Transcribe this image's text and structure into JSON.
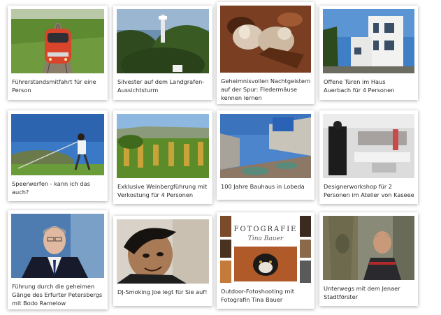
{
  "cards": [
    {
      "caption": "Führerstandsmitfahrt für eine Person",
      "icon": "train-photo"
    },
    {
      "caption": "Silvester auf dem Landgrafen-Aussichtsturm",
      "icon": "tower-photo"
    },
    {
      "caption": "Geheimnisvollen Nachtgeistern auf der Spur: Fledermäuse kennen lernen",
      "icon": "bats-photo"
    },
    {
      "caption": "Offene Türen im Haus Auerbach für 4 Personen",
      "icon": "house-photo"
    },
    {
      "caption": "Speerwerfen - kann ich das auch?",
      "icon": "javelin-photo"
    },
    {
      "caption": "Exklusive Weinbergführung mit Verkostung für 4 Personen",
      "icon": "vineyard-photo"
    },
    {
      "caption": "100 Jahre Bauhaus in Lobeda",
      "icon": "bauhaus-photo"
    },
    {
      "caption": "Designerworkshop für 2 Personen im Atelier von Kaseee",
      "icon": "atelier-photo"
    },
    {
      "caption": "Führung durch die geheimen Gänge des Erfurter Petersbergs mit Bodo Ramelow",
      "icon": "portrait-photo"
    },
    {
      "caption": "DJ-Smoking Joe legt für Sie auf!",
      "icon": "dj-photo"
    },
    {
      "caption": "Outdoor-Fotoshooting mit Fotografin Tina Bauer",
      "icon": "photography-photo"
    },
    {
      "caption": "Unterwegs mit dem Jenaer Stadtförster",
      "icon": "forester-photo"
    }
  ],
  "photo_text": {
    "fotografie_title": "FOTOGRAFIE",
    "fotografie_name": "Tina Bauer"
  }
}
